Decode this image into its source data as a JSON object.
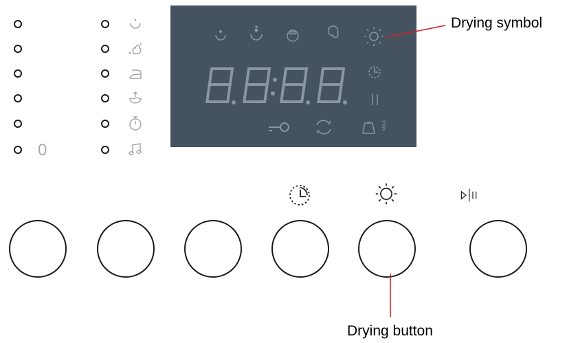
{
  "display": {
    "digits": "8.8:8.8.",
    "top_icons": [
      "rinse-icon",
      "spin-icon",
      "prewash-icon",
      "intensive-icon",
      "drying-icon"
    ],
    "side_icons": [
      "delay-clock-icon",
      "pause-bars-icon"
    ],
    "bottom_icons": [
      "child-lock-icon",
      "repeat-icon",
      "max-load-icon"
    ]
  },
  "left_panel": {
    "zero_label": "0",
    "option_icons": [
      "rinse-icon",
      "stain-icon",
      "iron-icon",
      "steam-icon",
      "timer-icon",
      "music-note-icon"
    ]
  },
  "buttons": {
    "icons": [
      "",
      "",
      "",
      "delay-clock-icon",
      "drying-icon",
      "play-pause-icon"
    ]
  },
  "annotations": {
    "drying_symbol": "Drying symbol",
    "drying_button": "Drying button",
    "leader_color": "#d9202a"
  }
}
